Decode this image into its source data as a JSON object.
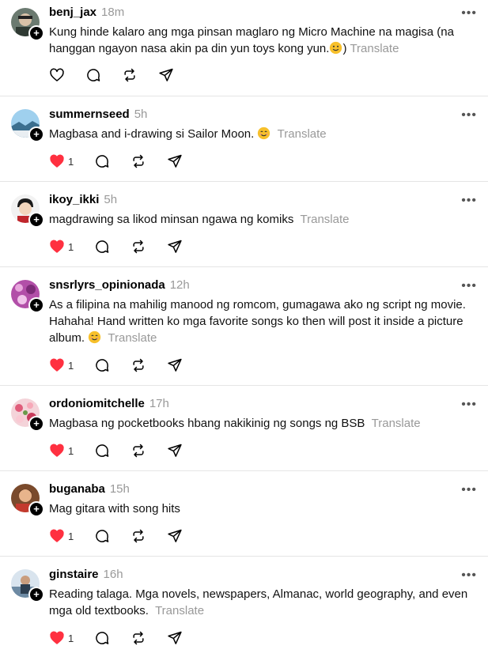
{
  "posts": [
    {
      "username": "benj_jax",
      "time": "18m",
      "text": "Kung hinde kalaro ang mga pinsan maglaro ng Micro Machine na magisa (na hanggan ngayon nasa akin pa din yun toys kong yun.",
      "text_after_emoji": ")",
      "translate": "Translate",
      "liked": false,
      "likes": ""
    },
    {
      "username": "summernseed",
      "time": "5h",
      "text": "Magbasa and i-drawing si Sailor Moon.",
      "translate": "Translate",
      "liked": true,
      "likes": "1"
    },
    {
      "username": "ikoy_ikki",
      "time": "5h",
      "text": "magdrawing sa likod minsan ngawa ng komiks",
      "translate": "Translate",
      "liked": true,
      "likes": "1"
    },
    {
      "username": "snsrlyrs_opinionada",
      "time": "12h",
      "text": "As a filipina na mahilig manood ng romcom, gumagawa ako ng script ng movie. Hahaha! Hand written ko mga favorite songs ko then will post it inside a picture album.",
      "translate": "Translate",
      "liked": true,
      "likes": "1"
    },
    {
      "username": "ordoniomitchelle",
      "time": "17h",
      "text": "Magbasa ng pocketbooks hbang nakikinig ng songs ng BSB",
      "translate": "Translate",
      "liked": true,
      "likes": "1"
    },
    {
      "username": "buganaba",
      "time": "15h",
      "text": "Mag gitara with song hits",
      "translate": "",
      "liked": true,
      "likes": "1"
    },
    {
      "username": "ginstaire",
      "time": "16h",
      "text": "Reading talaga. Mga novels, newspapers, Almanac, world geography, and even mga old textbooks.",
      "translate": "Translate",
      "liked": true,
      "likes": "1"
    }
  ],
  "ui": {
    "more_label": "•••",
    "follow_label": "+"
  },
  "colors": {
    "like_red": "#ff3040",
    "muted": "#999999",
    "divider": "#e5e5e5"
  }
}
